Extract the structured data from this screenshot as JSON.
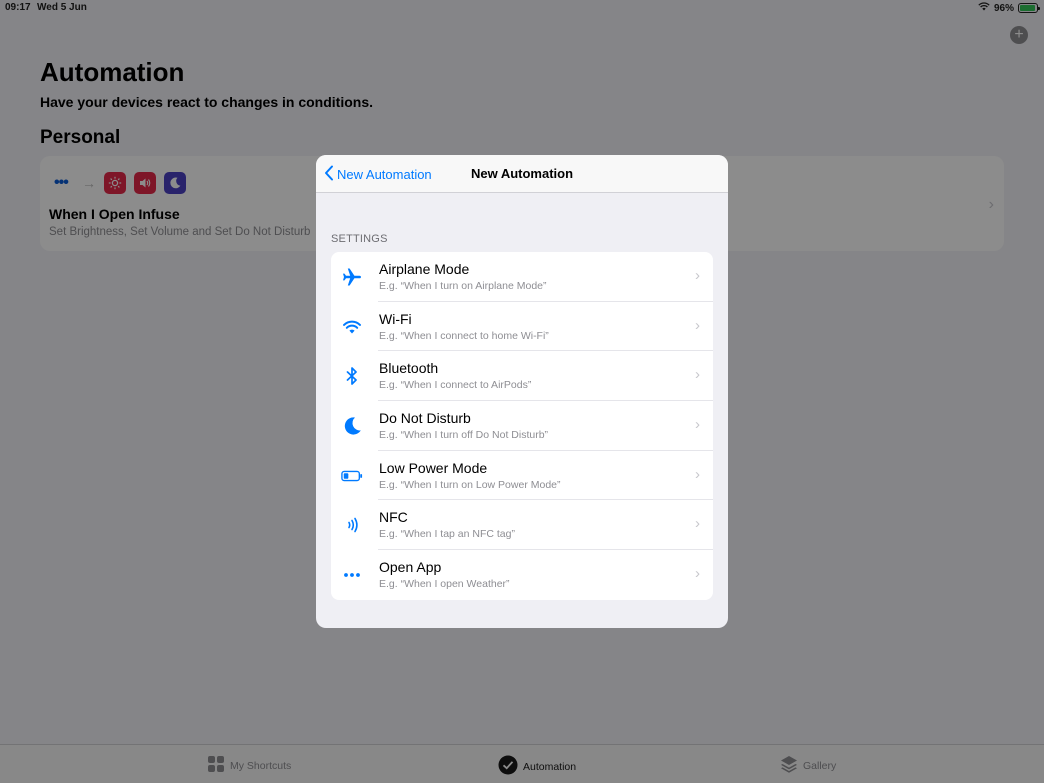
{
  "status_bar": {
    "time": "09:17",
    "date": "Wed 5 Jun",
    "battery": "96%",
    "battery_level": 0.96
  },
  "page": {
    "title": "Automation",
    "subtitle": "Have your devices react to changes in conditions.",
    "section": "Personal"
  },
  "card": {
    "title": "When I Open Infuse",
    "subtitle": "Set Brightness, Set Volume and Set Do Not Disturb"
  },
  "tabs": [
    {
      "label": "My Shortcuts",
      "icon": "grid-icon"
    },
    {
      "label": "Automation",
      "icon": "check-circle-icon"
    },
    {
      "label": "Gallery",
      "icon": "layers-icon"
    }
  ],
  "modal": {
    "back_label": "New Automation",
    "title": "New Automation",
    "section_header": "SETTINGS",
    "rows": [
      {
        "title": "Airplane Mode",
        "subtitle": "E.g. “When I turn on Airplane Mode”",
        "icon": "airplane-icon"
      },
      {
        "title": "Wi-Fi",
        "subtitle": "E.g. “When I connect to home Wi-Fi”",
        "icon": "wifi-icon"
      },
      {
        "title": "Bluetooth",
        "subtitle": "E.g. “When I connect to AirPods”",
        "icon": "bluetooth-icon"
      },
      {
        "title": "Do Not Disturb",
        "subtitle": "E.g. “When I turn off Do Not Disturb”",
        "icon": "moon-icon"
      },
      {
        "title": "Low Power Mode",
        "subtitle": "E.g. “When I turn on Low Power Mode”",
        "icon": "battery-icon"
      },
      {
        "title": "NFC",
        "subtitle": "E.g. “When I tap an NFC tag”",
        "icon": "nfc-icon"
      },
      {
        "title": "Open App",
        "subtitle": "E.g. “When I open Weather”",
        "icon": "more-icon"
      }
    ]
  },
  "colors": {
    "accent": "#007aff",
    "overlay": "rgba(0,0,0,0.45)"
  }
}
